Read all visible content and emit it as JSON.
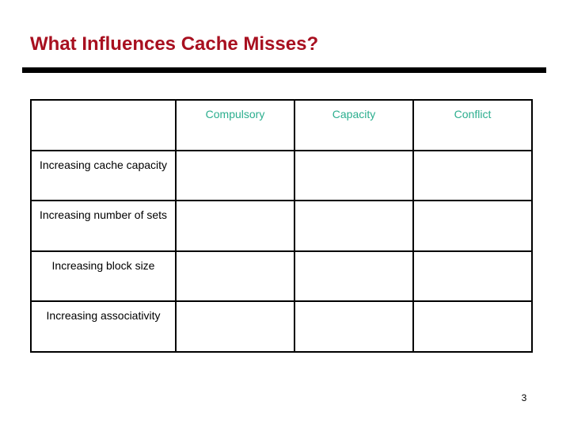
{
  "slide": {
    "title": "What Influences Cache Misses?",
    "title_color": "#a81020",
    "rule_color": "#000000",
    "background_color": "#ffffff",
    "page_number": "3"
  },
  "table": {
    "corner_label": "",
    "header_color": "#2bae8e",
    "border_color": "#000000",
    "columns": [
      {
        "label": "Compulsory"
      },
      {
        "label": "Capacity"
      },
      {
        "label": "Conflict"
      }
    ],
    "rows": [
      {
        "label": "Increasing cache capacity",
        "cells": [
          "",
          "",
          ""
        ]
      },
      {
        "label": "Increasing number of sets",
        "cells": [
          "",
          "",
          ""
        ]
      },
      {
        "label": "Increasing block size",
        "cells": [
          "",
          "",
          ""
        ]
      },
      {
        "label": "Increasing associativity",
        "cells": [
          "",
          "",
          ""
        ]
      }
    ]
  }
}
